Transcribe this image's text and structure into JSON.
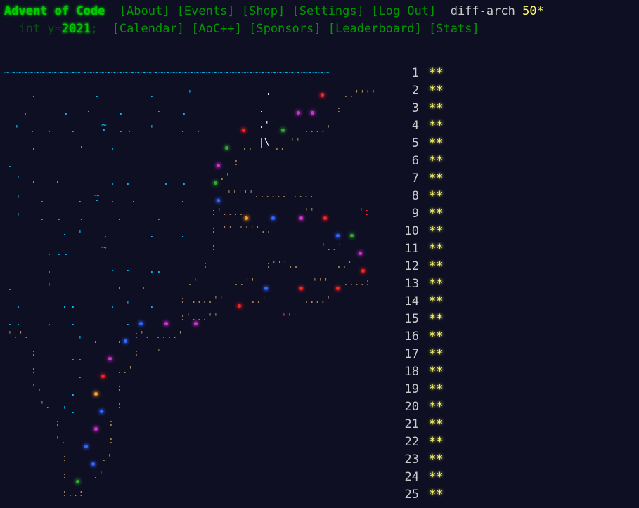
{
  "header": {
    "title": "Advent of Code",
    "year_prefix": "int y=",
    "year": "2021",
    "year_suffix": ";",
    "nav_row1": [
      "[About]",
      "[Events]",
      "[Shop]",
      "[Settings]",
      "[Log Out]"
    ],
    "nav_row2": [
      "[Calendar]",
      "[AoC++]",
      "[Sponsors]",
      "[Leaderboard]",
      "[Stats]"
    ],
    "user": "diff-arch",
    "star_count": "50*"
  },
  "calendar": {
    "wave": "~~~~~~~~~~~~~~~~~~~~~~~~~~~~~~~~~~~~~~~~~~~~~~~~~~~~~~~",
    "star_mark": "**",
    "days": [
      "1",
      "2",
      "3",
      "4",
      "5",
      "6",
      "7",
      "8",
      "9",
      "10",
      "11",
      "12",
      "13",
      "14",
      "15",
      "16",
      "17",
      "18",
      "19",
      "20",
      "21",
      "22",
      "23",
      "24",
      "25"
    ]
  },
  "colors": {
    "background": "#0f0f23",
    "title": "#00cc00",
    "nav": "#009900",
    "gold": "#ffff66",
    "sea": "#00ccff",
    "rock": "#aa8855"
  }
}
